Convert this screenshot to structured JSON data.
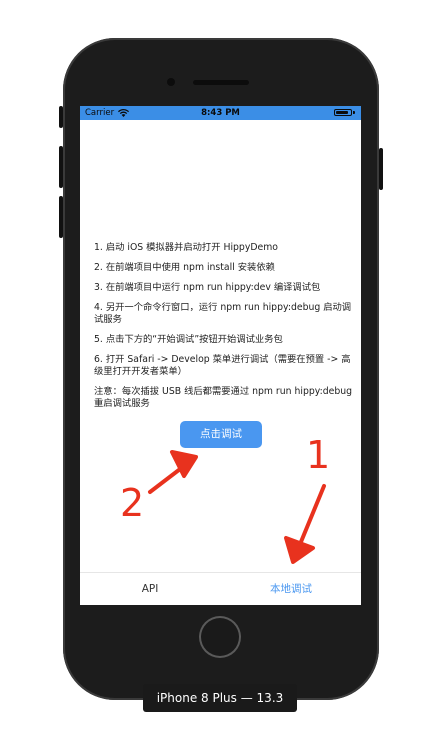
{
  "status_bar": {
    "carrier": "Carrier",
    "time": "8:43 PM",
    "battery_level_percent": 85
  },
  "instructions": [
    "1. 启动 iOS 模拟器并启动打开 HippyDemo",
    "2. 在前端项目中使用 npm install 安装依赖",
    "3. 在前端项目中运行 npm run hippy:dev 编译调试包",
    "4. 另开一个命令行窗口，运行 npm run hippy:debug 启动调试服务",
    "5. 点击下方的“开始调试”按钮开始调试业务包",
    "6. 打开 Safari -> Develop 菜单进行调试（需要在预置 -> 高级里打开开发者菜单）",
    "注意：每次插拔 USB 线后都需要通过 npm run hippy:debug 重启调试服务"
  ],
  "debug_button_label": "点击调试",
  "tabs": [
    {
      "label": "API",
      "active": false
    },
    {
      "label": "本地调试",
      "active": true
    }
  ],
  "annotations": {
    "marker_1": "1",
    "marker_2": "2",
    "color": "#e8321e"
  },
  "device_label": "iPhone 8 Plus — 13.3",
  "colors": {
    "status_bar_bg": "#3b8ee6",
    "accent": "#4a97f0",
    "phone_body": "#1c1c1c"
  }
}
